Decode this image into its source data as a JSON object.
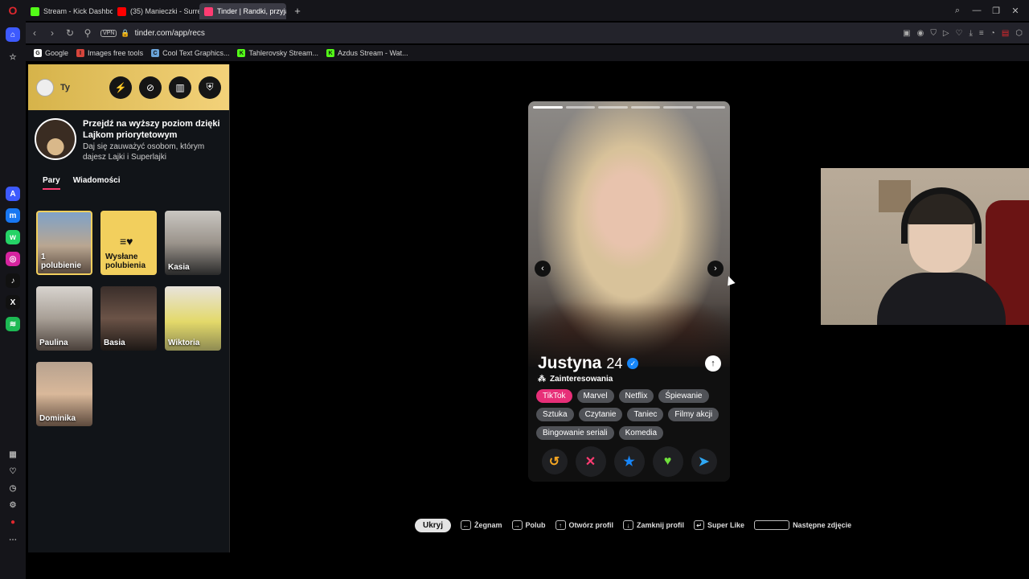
{
  "browser": {
    "tabs": [
      {
        "label": "Stream - Kick Dashboard",
        "active": false,
        "color": "#53fc18"
      },
      {
        "label": "(35) Manieczki - Surre",
        "active": false,
        "color": "#ff0000"
      },
      {
        "label": "Tinder | Randki, przyjaźń",
        "active": true,
        "color": "#fe3c72"
      }
    ],
    "new_tab_symbol": "+",
    "vpn_label": "VPN",
    "url": "tinder.com/app/recs",
    "bookmarks": [
      {
        "label": "Google",
        "icon": "G",
        "color": "#ffffff"
      },
      {
        "label": "Images free tools",
        "icon": "I",
        "color": "#d6453c"
      },
      {
        "label": "Cool Text Graphics...",
        "icon": "C",
        "color": "#6aa3d8"
      },
      {
        "label": "Tahlerovsky Stream...",
        "icon": "K",
        "color": "#53fc18"
      },
      {
        "label": "Azdus Stream - Wat...",
        "icon": "K",
        "color": "#53fc18"
      }
    ]
  },
  "sidebar_apps": [
    {
      "name": "aria-icon",
      "color": "#3d5afe",
      "glyph": "A"
    },
    {
      "name": "messenger-icon",
      "color": "#1877f2",
      "glyph": "m"
    },
    {
      "name": "whatsapp-icon",
      "color": "#25d366",
      "glyph": "w"
    },
    {
      "name": "instagram-icon",
      "color": "#d6249f",
      "glyph": "◎"
    },
    {
      "name": "tiktok-icon",
      "color": "#111111",
      "glyph": "♪"
    },
    {
      "name": "x-icon",
      "color": "#111111",
      "glyph": "X"
    },
    {
      "name": "spotify-icon",
      "color": "#1db954",
      "glyph": "≋"
    }
  ],
  "tinder": {
    "user_label": "Ty",
    "promo": {
      "title": "Przejdź na wyższy poziom dzięki Lajkom priorytetowym",
      "subtitle": "Daj się zauważyć osobom, którym dajesz Lajki i Superlajki"
    },
    "tabs": [
      "Pary",
      "Wiadomości"
    ],
    "tiles": [
      {
        "label": "1 polubienie",
        "type": "likes"
      },
      {
        "label": "Wysłane polubienia",
        "type": "sent"
      },
      {
        "label": "Kasia",
        "type": "match"
      },
      {
        "label": "Paulina",
        "type": "match"
      },
      {
        "label": "Basia",
        "type": "match"
      },
      {
        "label": "Wiktoria",
        "type": "match"
      },
      {
        "label": "Dominika",
        "type": "match"
      }
    ],
    "profile": {
      "name": "Justyna",
      "age": "24",
      "interests_heading": "Zainteresowania",
      "interests": [
        "TikTok",
        "Marvel",
        "Netflix",
        "Śpiewanie",
        "Sztuka",
        "Czytanie",
        "Taniec",
        "Filmy akcji",
        "Bingowanie seriali",
        "Komedia"
      ],
      "photo_count": 6,
      "photo_index": 1
    },
    "actions": [
      {
        "name": "rewind",
        "glyph": "↺",
        "color": "#f5a623"
      },
      {
        "name": "nope",
        "glyph": "✕",
        "color": "#fe3c72"
      },
      {
        "name": "super-like",
        "glyph": "★",
        "color": "#1786f8"
      },
      {
        "name": "like",
        "glyph": "♥",
        "color": "#6fe03c"
      },
      {
        "name": "boost",
        "glyph": "➤",
        "color": "#2fa8f5"
      }
    ]
  },
  "shortcuts": {
    "hide_label": "Ukryj",
    "items": [
      {
        "key": "←",
        "label": "Żegnam"
      },
      {
        "key": "→",
        "label": "Polub"
      },
      {
        "key": "↑",
        "label": "Otwórz profil"
      },
      {
        "key": "↓",
        "label": "Zamknij profil"
      },
      {
        "key": "↵",
        "label": "Super Like"
      },
      {
        "key": "",
        "label": "Następne zdjęcie",
        "space": true
      }
    ]
  }
}
